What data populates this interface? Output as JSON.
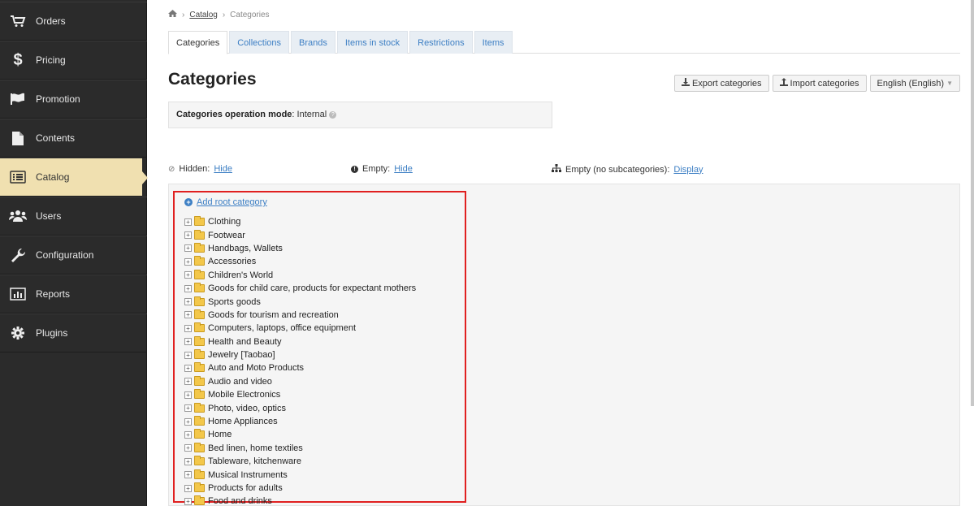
{
  "sidebar": {
    "items": [
      {
        "label": "Orders",
        "icon": "cart-icon"
      },
      {
        "label": "Pricing",
        "icon": "dollar-icon"
      },
      {
        "label": "Promotion",
        "icon": "flag-icon"
      },
      {
        "label": "Contents",
        "icon": "document-icon"
      },
      {
        "label": "Catalog",
        "icon": "list-icon",
        "active": true
      },
      {
        "label": "Users",
        "icon": "users-icon"
      },
      {
        "label": "Configuration",
        "icon": "wrench-icon"
      },
      {
        "label": "Reports",
        "icon": "bar-chart-icon"
      },
      {
        "label": "Plugins",
        "icon": "gear-icon"
      }
    ]
  },
  "breadcrumb": {
    "catalog": "Catalog",
    "current": "Categories"
  },
  "tabs": [
    "Categories",
    "Collections",
    "Brands",
    "Items in stock",
    "Restrictions",
    "Items"
  ],
  "page": {
    "title": "Categories"
  },
  "toolbar": {
    "export": "Export categories",
    "import": "Import categories",
    "language": "English (English)"
  },
  "mode": {
    "label": "Categories operation mode",
    "value": ": Internal"
  },
  "filters": {
    "hidden_label": "Hidden:",
    "hidden_action": "Hide",
    "empty_label": "Empty:",
    "empty_action": "Hide",
    "nosub_label": "Empty (no subcategories):",
    "nosub_action": "Display"
  },
  "tree": {
    "add_root": "Add root category",
    "categories": [
      "Clothing",
      "Footwear",
      "Handbags, Wallets",
      "Accessories",
      "Children's World",
      "Goods for child care, products for expectant mothers",
      "Sports goods",
      "Goods for tourism and recreation",
      "Computers, laptops, office equipment",
      "Health and Beauty",
      "Jewelry [Taobao]",
      "Auto and Moto Products",
      "Audio and video",
      "Mobile Electronics",
      "Photo, video, optics",
      "Home Appliances",
      "Home",
      "Bed linen, home textiles",
      "Tableware, kitchenware",
      "Musical Instruments",
      "Products for adults",
      "Food and drinks"
    ]
  },
  "colors": {
    "accent": "#3d7fc4",
    "sidebar_bg": "#2b2b2b",
    "active_bg": "#f0e0b0",
    "highlight": "#e02020"
  }
}
